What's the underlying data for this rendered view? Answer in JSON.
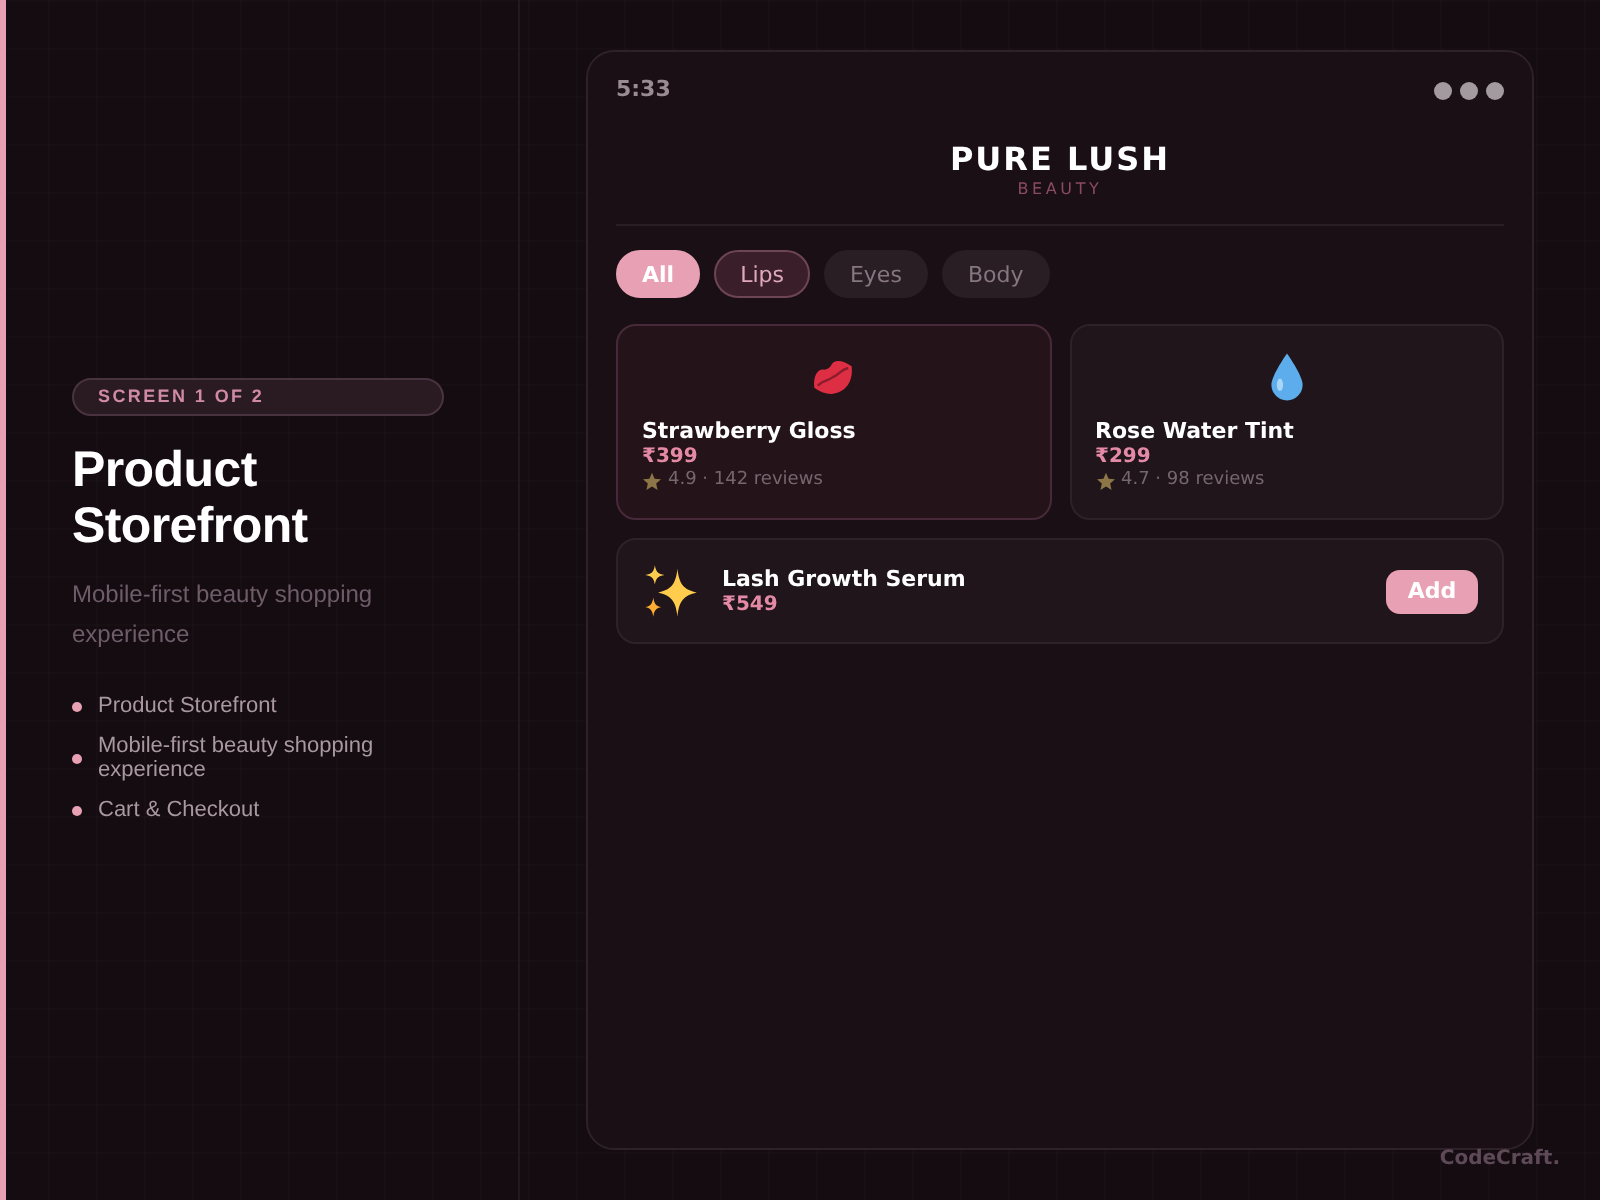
{
  "sidebar": {
    "badge": "SCREEN 1 OF 2",
    "title": "Product Storefront",
    "subtitle": "Mobile-first beauty shopping experience",
    "features": [
      "Product Storefront",
      "Mobile-first beauty shopping experience",
      "Cart & Checkout"
    ]
  },
  "phone": {
    "status_bar": {
      "time": "5:33"
    },
    "brand": {
      "name": "PURE LUSH",
      "tagline": "BEAUTY"
    },
    "filters": [
      {
        "label": "All",
        "selected": true,
        "focused": false
      },
      {
        "label": "Lips",
        "selected": false,
        "focused": true
      },
      {
        "label": "Eyes",
        "selected": false,
        "focused": false
      },
      {
        "label": "Body",
        "selected": false,
        "focused": false
      }
    ],
    "products": [
      {
        "kind": "card",
        "name": "Strawberry Gloss",
        "price": "₹399",
        "rating": "4.9 · 142 reviews",
        "selected": true
      },
      {
        "kind": "card",
        "name": "Rose Water Tint",
        "price": "₹299",
        "rating": "4.7 · 98 reviews",
        "selected": false
      },
      {
        "kind": "row",
        "name": "Lash Growth Serum",
        "price": "₹549",
        "button": "Add",
        "selected": false
      }
    ]
  },
  "footer": {
    "brand": "CodeCraft."
  }
}
